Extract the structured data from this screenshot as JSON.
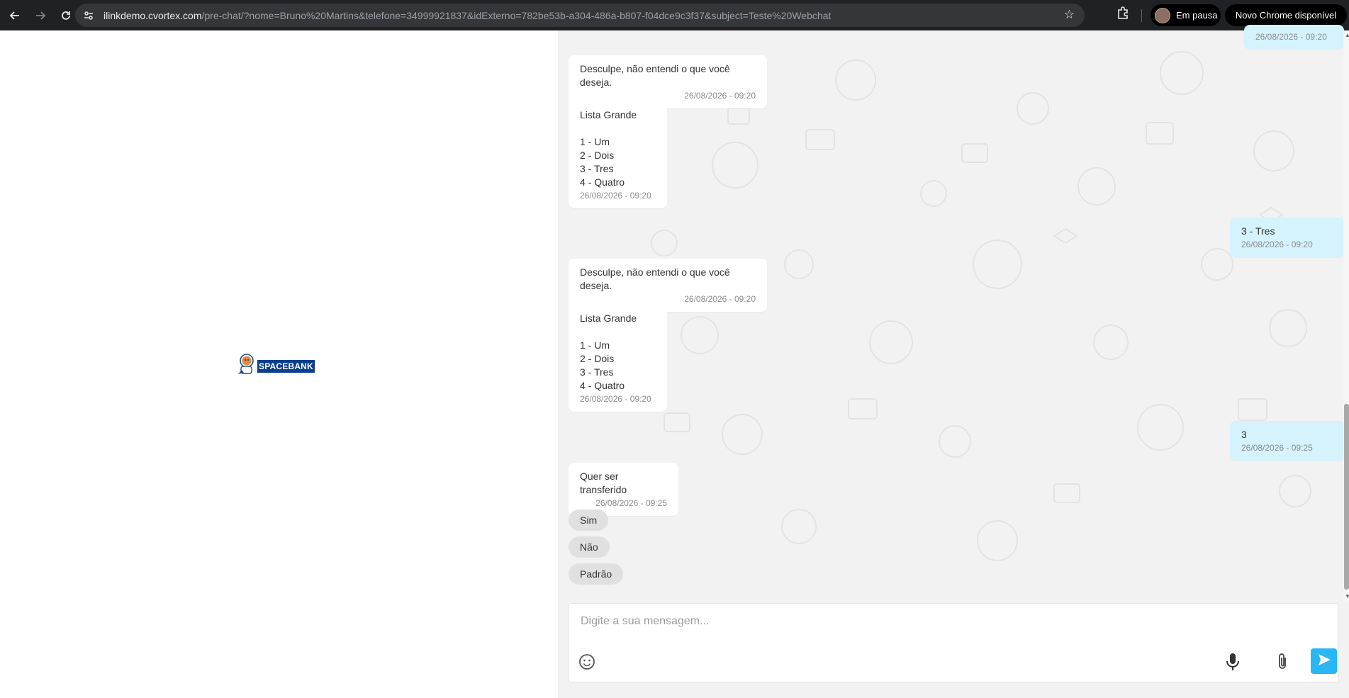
{
  "browser": {
    "url_host": "ilinkdemo.cvortex.com",
    "url_path": "/pre-chat/?nome=Bruno%20Martins&telefone=34999921837&idExterno=782be53b-a304-486a-b807-f04dce9c3f37&subject=Teste%20Webchat",
    "profile_label": "Em pausa",
    "update_label": "Novo Chrome disponível",
    "icons": [
      "back-icon",
      "forward-icon",
      "reload-icon",
      "site-settings-icon",
      "star-icon",
      "extensions-icon"
    ]
  },
  "brand": {
    "name": "SPACEBANK",
    "logo_icon": "astronaut-icon"
  },
  "chat": {
    "messages": [
      {
        "direction": "out",
        "text": "",
        "time": "26/08/2026 - 09:20"
      },
      {
        "direction": "in",
        "text": "Desculpe, não entendi o que você deseja.",
        "time": "26/08/2026 - 09:20"
      },
      {
        "direction": "in",
        "text": "Lista Grande\n\n1 - Um\n2 - Dois\n3 - Tres\n4 - Quatro",
        "time": "26/08/2026 - 09:20"
      },
      {
        "direction": "out",
        "text": "3 - Tres",
        "time": "26/08/2026 - 09:20"
      },
      {
        "direction": "in",
        "text": "Desculpe, não entendi o que você deseja.",
        "time": "26/08/2026 - 09:20"
      },
      {
        "direction": "in",
        "text": "Lista Grande\n\n1 - Um\n2 - Dois\n3 - Tres\n4 - Quatro",
        "time": "26/08/2026 - 09:20"
      },
      {
        "direction": "out",
        "text": "3",
        "time": "26/08/2026 - 09:25"
      },
      {
        "direction": "in",
        "text": "Quer ser transferido",
        "time": "26/08/2026 - 09:25"
      }
    ],
    "quick_replies": [
      "Sim",
      "Não",
      "Padrão"
    ]
  },
  "composer": {
    "placeholder": "Digite a sua mensagem...",
    "value": "",
    "icons": [
      "emoji-icon",
      "microphone-icon",
      "attach-icon",
      "send-icon"
    ]
  },
  "colors": {
    "outgoing_bubble": "#d4f3fc",
    "incoming_bubble": "#ffffff",
    "send_button": "#29b6f6",
    "brand_badge": "#0b3f8c"
  }
}
